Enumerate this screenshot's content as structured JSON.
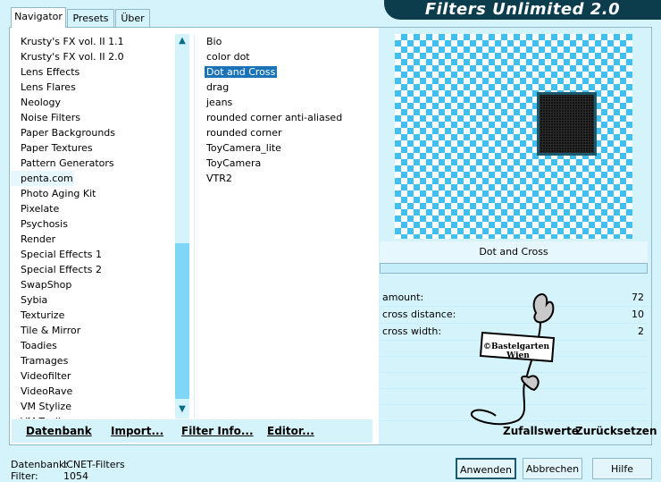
{
  "tabs": [
    {
      "label": "Navigator",
      "active": true
    },
    {
      "label": "Presets",
      "active": false
    },
    {
      "label": "Über",
      "active": false
    }
  ],
  "banner": "Filters Unlimited 2.0",
  "categories": [
    "Krusty's FX vol. II 1.1",
    "Krusty's FX vol. II 2.0",
    "Lens Effects",
    "Lens Flares",
    "Neology",
    "Noise Filters",
    "Paper Backgrounds",
    "Paper Textures",
    "Pattern Generators",
    "penta.com",
    "Photo Aging Kit",
    "Pixelate",
    "Psychosis",
    "Render",
    "Special Effects 1",
    "Special Effects 2",
    "SwapShop",
    "Sybia",
    "Texturize",
    "Tile & Mirror",
    "Toadies",
    "Tramages",
    "Videofilter",
    "VideoRave",
    "VM Stylize",
    "VM Toolbox"
  ],
  "selected_category": "penta.com",
  "filters": [
    "Bio",
    "color dot",
    "Dot and Cross",
    "drag",
    "jeans",
    "rounded corner anti-aliased",
    "rounded corner",
    "ToyCamera_lite",
    "ToyCamera",
    "VTR2"
  ],
  "selected_filter": "Dot and Cross",
  "filter_name": "Dot and Cross",
  "params": [
    {
      "label": "amount:",
      "value": "72"
    },
    {
      "label": "cross distance:",
      "value": "10"
    },
    {
      "label": "cross width:",
      "value": "2"
    }
  ],
  "bottom": {
    "datenbank": "Datenbank",
    "import": "Import...",
    "filterinfo": "Filter Info...",
    "editor": "Editor...",
    "zufall": "Zufallswerte",
    "reset": "Zurücksetzen"
  },
  "status": {
    "db_label": "Datenbank:",
    "db_value": "ICNET-Filters",
    "filter_label": "Filter:",
    "filter_value": "1054"
  },
  "buttons": {
    "apply": "Anwenden",
    "cancel": "Abbrechen",
    "help": "Hilfe"
  },
  "watermark": {
    "line1": "©Bastelgarten",
    "line2": "Wien"
  },
  "colors": {
    "panel": "#d5f3fb",
    "accent": "#1a73b6",
    "checker": "#3fc0f0",
    "banner": "#0c3d4c"
  }
}
